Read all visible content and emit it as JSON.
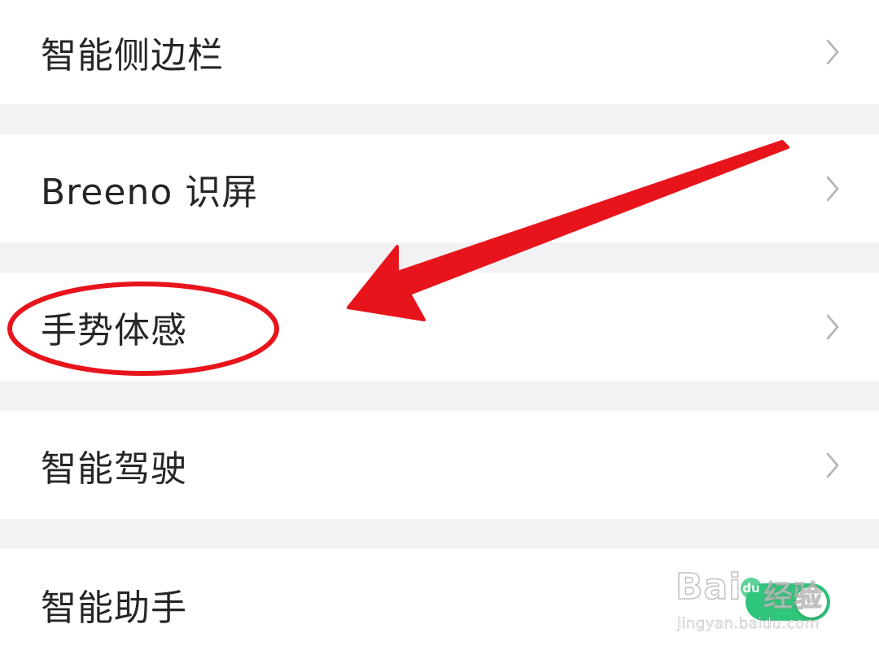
{
  "settings": {
    "items": [
      {
        "label": "智能侧边栏",
        "control": "chevron"
      },
      {
        "label": "Breeno 识屏",
        "control": "chevron"
      },
      {
        "label": "手势体感",
        "control": "chevron"
      },
      {
        "label": "智能驾驶",
        "control": "chevron"
      },
      {
        "label": "智能助手",
        "control": "toggle",
        "toggle_on": true
      }
    ]
  },
  "watermark": {
    "brand": "Bai",
    "badge": "du",
    "word": "经验",
    "url": "jingyan.baidu.com"
  },
  "colors": {
    "page_background": "#f2f1f3",
    "row_background": "#ffffff",
    "text": "#262626",
    "chevron": "#b3b3b3",
    "toggle_on": "#2fc57a",
    "annotation": "#e8141c"
  },
  "icons": {
    "chevron": "chevron-right-icon"
  }
}
